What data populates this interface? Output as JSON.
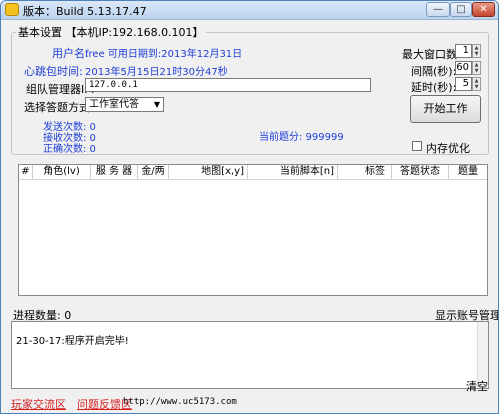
{
  "window": {
    "title": "版本：Build 5.13.17.47"
  },
  "titlebar_buttons": {
    "min": "—",
    "max": "□",
    "close": "✕"
  },
  "group": {
    "title": "基本设置 【本机IP:192.168.0.101】"
  },
  "user": {
    "name_label": "用户名:",
    "name_value": "free 可用日期到:2013年12月31日",
    "heartbeat_label": "心跳包时间:",
    "heartbeat_value": "2013年5月15日21时30分47秒"
  },
  "manager": {
    "label": "组队管理器IP:",
    "value": "127.0.0.1"
  },
  "answer_mode": {
    "label": "选择答题方式:",
    "selected": "工作室代答"
  },
  "stats": {
    "sent": "发送次数: 0",
    "received": "接收次数: 0",
    "correct": "正确次数: 0",
    "current_points": "当前题分: 999999"
  },
  "settings": {
    "max_windows_label": "最大窗口数:",
    "max_windows_value": "1",
    "interval_label": "间隔(秒):",
    "interval_value": "60",
    "delay_label": "延时(秒):",
    "delay_value": "5"
  },
  "start_button": "开始工作",
  "memory_opt": "内存优化",
  "table": {
    "columns": [
      "#",
      "角色(lv)",
      "服 务 器",
      "金/两",
      "地图[x,y]",
      "当前脚本[n]",
      "标签",
      "答题状态",
      "题量"
    ]
  },
  "process_count": "进程数量: 0",
  "show_account": "显示账号管理",
  "log": {
    "lines": [
      "21-30-17:程序开启完毕!"
    ]
  },
  "clear_button": "清空",
  "status_bar": {
    "link1": "玩家交流区",
    "link2": "问题反馈区",
    "url": "http://www.uc5173.com"
  }
}
